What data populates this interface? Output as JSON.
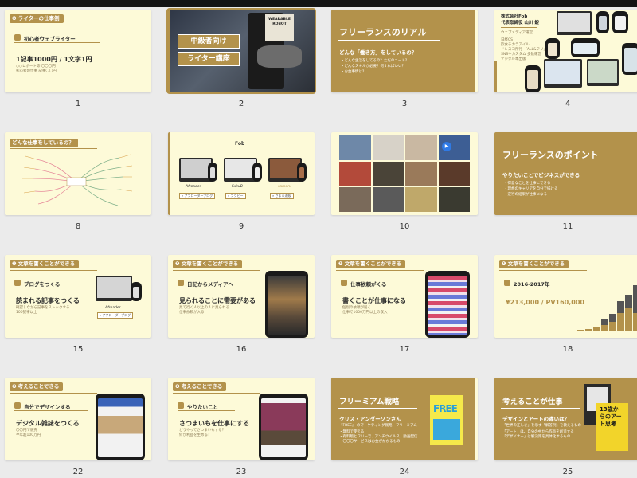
{
  "colors": {
    "accent": "#b3924b",
    "cream": "#fdfad8",
    "canvas": "#ebebeb"
  },
  "slides": {
    "s1": {
      "number": "1",
      "badge": "❶ ライターの仕事例",
      "subheading": "初心者ウェブライター",
      "headline": "1記事1000円 / 1文字1円",
      "note1": "○○レポート等 〇〇〇円",
      "note2": "初心者の仕事 記事〇〇円"
    },
    "s2": {
      "number": "2",
      "line1": "中級者向け",
      "line2": "ライター講座",
      "book_text": "WEARABLE ROBOT"
    },
    "s3": {
      "number": "3",
      "title": "フリーランスのリアル",
      "subtitle": "どんな「働き方」をしているの？",
      "bullets": [
        "どんな生活をしてるの？ただのニート？",
        "どんなスキルが必要？何すればいい？",
        "お金事情は？"
      ]
    },
    "s4": {
      "number": "4",
      "company": "株式会社Fob",
      "person": "代表取締役 山川 錠",
      "lines": [
        "ウェブメディア運営",
        "日経CS",
        "飲食チカラアイル",
        "ドレスコ所行 「ALL&フリ」",
        "SNSやカスタム 多数運営",
        "デジタル本出版"
      ]
    },
    "s8": {
      "number": "8",
      "title": "どんな仕事をしているの？"
    },
    "s9": {
      "number": "9",
      "logo": "Fob",
      "cards": [
        {
          "label": "アフローダーブログ",
          "logo": "Afroader"
        },
        {
          "label": "フクヒー",
          "logo": "FukuB"
        },
        {
          "label": "さまる通販",
          "logo": "samaru"
        }
      ]
    },
    "s10": {
      "number": "10"
    },
    "s11": {
      "number": "11",
      "title": "フリーランスのポイント",
      "subtitle": "やりたいことでビジネスができる",
      "bullets": [
        "得意なことを仕事にできる",
        "理想のキャリアを自分で描ける",
        "逆行の結果が仕事になる"
      ]
    },
    "s15": {
      "number": "15",
      "badge": "❶ 文章を書くことができる",
      "subheading": "ブログをつくる",
      "headline": "読まれる記事をつくる",
      "note1": "確認しながら記事をストックする",
      "note2": "100記事以上",
      "caption": "アフローダーブログ",
      "logo": "Afroader"
    },
    "s16": {
      "number": "16",
      "badge": "❶ 文章を書くことができる",
      "subheading": "日記からメディアへ",
      "headline": "見られることに需要がある",
      "note1": "見て行く人以上の人に見られる",
      "note2": "仕事依頼が入る"
    },
    "s17": {
      "number": "17",
      "badge": "❶ 文章を書くことができる",
      "subheading": "仕事依頼がくる",
      "headline": "書くことが仕事になる",
      "note1": "個別の依頼が届く",
      "note2": "仕事で1000万円以上の収入"
    },
    "s18": {
      "number": "18",
      "badge": "❶ 文章を書くことができる",
      "subheading": "2016-2017年",
      "headline": "¥213,000 / PV160,000"
    },
    "s22": {
      "number": "22",
      "badge": "❷ 考えることできる",
      "subheading": "自分でデザインする",
      "headline": "デジタル雑誌をつくる",
      "note1": "〇〇円で販売",
      "note2": "半年超100万円"
    },
    "s23": {
      "number": "23",
      "badge": "❷ 考えることできる",
      "subheading": "やりたいこと",
      "headline": "さつまいもを仕事にする",
      "note1": "どうやってさつまいもする？",
      "note2": "何が利益を生める？"
    },
    "s24": {
      "number": "24",
      "title": "フリーミアム戦略",
      "author": "クリス・アンダーソンさん",
      "lines": [
        "『FREE』 のマーケティング戦略　フリーミアム",
        "・無料で使える",
        "・有料版とフリーで、アンチウイルス、動画配信",
        "・〇〇〇サービスはお金がかかるもの"
      ],
      "book": "FREE"
    },
    "s25": {
      "number": "25",
      "title": "考えることが仕事",
      "subtitle": "デザインとアートの違いは？",
      "lines": [
        "「世界の正しさ」を示す「解答例」を教えるもの",
        "「アート」は、自分の中から作品を創造する",
        "「デザイナー」は解決策を具体化するもの"
      ],
      "book": "13歳からのアート思考"
    }
  }
}
